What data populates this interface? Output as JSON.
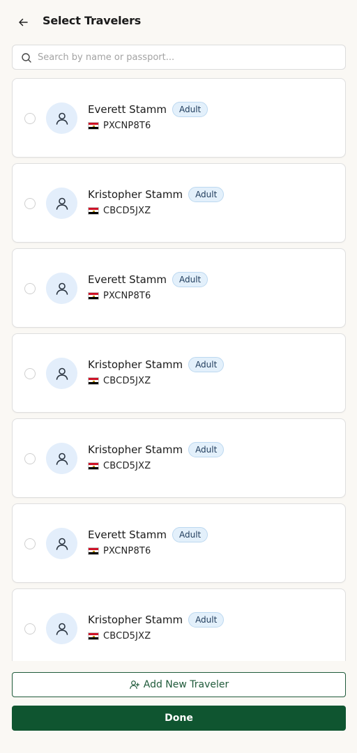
{
  "header": {
    "title": "Select Travelers",
    "back_icon": "arrow-left-icon"
  },
  "search": {
    "placeholder": "Search by name or passport...",
    "value": "",
    "icon": "search-icon"
  },
  "travelers": [
    {
      "name": "Everett Stamm",
      "type": "Adult",
      "passport": "PXCNP8T6",
      "flag": "egypt-flag-icon",
      "selected": false
    },
    {
      "name": "Kristopher Stamm",
      "type": "Adult",
      "passport": "CBCD5JXZ",
      "flag": "egypt-flag-icon",
      "selected": false
    },
    {
      "name": "Everett Stamm",
      "type": "Adult",
      "passport": "PXCNP8T6",
      "flag": "egypt-flag-icon",
      "selected": false
    },
    {
      "name": "Kristopher Stamm",
      "type": "Adult",
      "passport": "CBCD5JXZ",
      "flag": "egypt-flag-icon",
      "selected": false
    },
    {
      "name": "Kristopher Stamm",
      "type": "Adult",
      "passport": "CBCD5JXZ",
      "flag": "egypt-flag-icon",
      "selected": false
    },
    {
      "name": "Everett Stamm",
      "type": "Adult",
      "passport": "PXCNP8T6",
      "flag": "egypt-flag-icon",
      "selected": false
    },
    {
      "name": "Kristopher Stamm",
      "type": "Adult",
      "passport": "CBCD5JXZ",
      "flag": "egypt-flag-icon",
      "selected": false
    }
  ],
  "footer": {
    "add_label": "Add New Traveler",
    "add_icon": "user-plus-icon",
    "done_label": "Done"
  },
  "colors": {
    "primary": "#0f5530",
    "badge_bg": "#e3f0fb",
    "avatar_bg": "#e3eefb",
    "background": "#faf8f4"
  }
}
